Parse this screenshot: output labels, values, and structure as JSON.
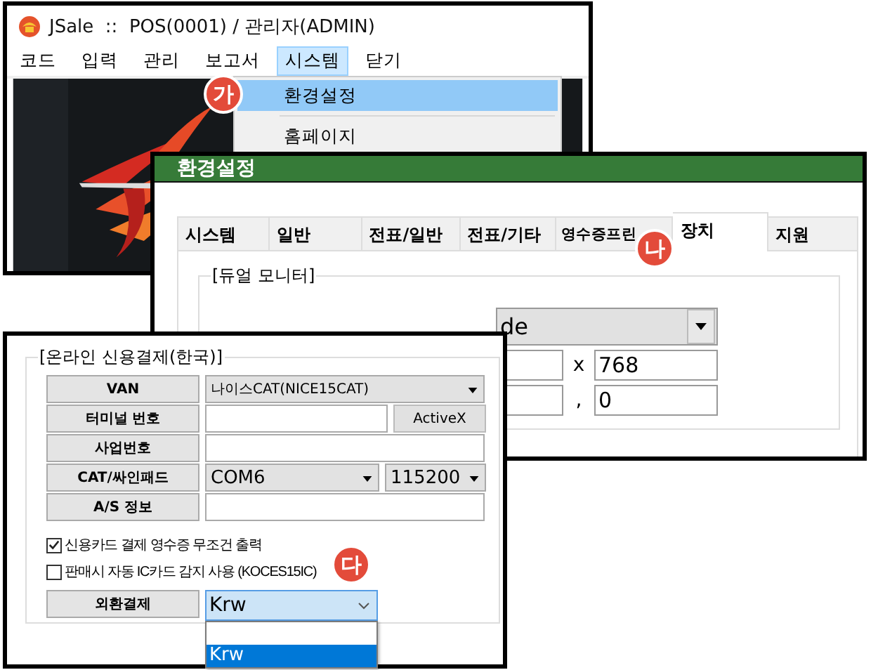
{
  "main_window": {
    "title": "JSale  ::  POS(0001) / 관리자(ADMIN)",
    "menu": [
      {
        "label": "코드",
        "selected": false
      },
      {
        "label": "입력",
        "selected": false
      },
      {
        "label": "관리",
        "selected": false
      },
      {
        "label": "보고서",
        "selected": false
      },
      {
        "label": "시스템",
        "selected": true
      },
      {
        "label": "닫기",
        "selected": false
      }
    ],
    "dropdown": [
      {
        "label": "환경설정",
        "selected": true
      },
      {
        "label": "홈페이지",
        "selected": false
      }
    ],
    "callout": "가"
  },
  "settings_window": {
    "title": "환경설정",
    "tabs": [
      {
        "label": "시스템",
        "selected": false
      },
      {
        "label": "일반",
        "selected": false
      },
      {
        "label": "전표/일반",
        "selected": false
      },
      {
        "label": "전표/기타",
        "selected": false
      },
      {
        "label": "영수증프린",
        "selected": false
      },
      {
        "label": "장치",
        "selected": true
      },
      {
        "label": "지원",
        "selected": false
      }
    ],
    "callout": "나",
    "group": "[듀얼 모니터]",
    "mode_select": {
      "value": "de"
    },
    "size_row": {
      "separator": "x",
      "value": "768"
    },
    "offset_row": {
      "separator": ",",
      "value": "0"
    }
  },
  "payment_panel": {
    "group": "[온라인 신용결제(한국)]",
    "rows": [
      {
        "label": "VAN",
        "kind": "select",
        "value": "나이스CAT(NICE15CAT)"
      },
      {
        "label": "터미널 번호",
        "kind": "input_button",
        "button": "ActiveX"
      },
      {
        "label": "사업번호",
        "kind": "input"
      },
      {
        "label": "CAT/싸인패드",
        "kind": "two_selects",
        "values": [
          "COM6",
          "115200"
        ]
      },
      {
        "label": "A/S 정보",
        "kind": "input"
      }
    ],
    "checkboxes": [
      {
        "label": "신용카드 결제 영수증 무조건 출력",
        "checked": true
      },
      {
        "label": "판매시 자동 IC카드 감지 사용 (KOCES15IC)",
        "checked": false
      }
    ],
    "currency": {
      "label": "외환결제",
      "value": "Krw",
      "options": [
        {
          "label": "Krw",
          "selected": true
        }
      ]
    },
    "callout": "다"
  }
}
